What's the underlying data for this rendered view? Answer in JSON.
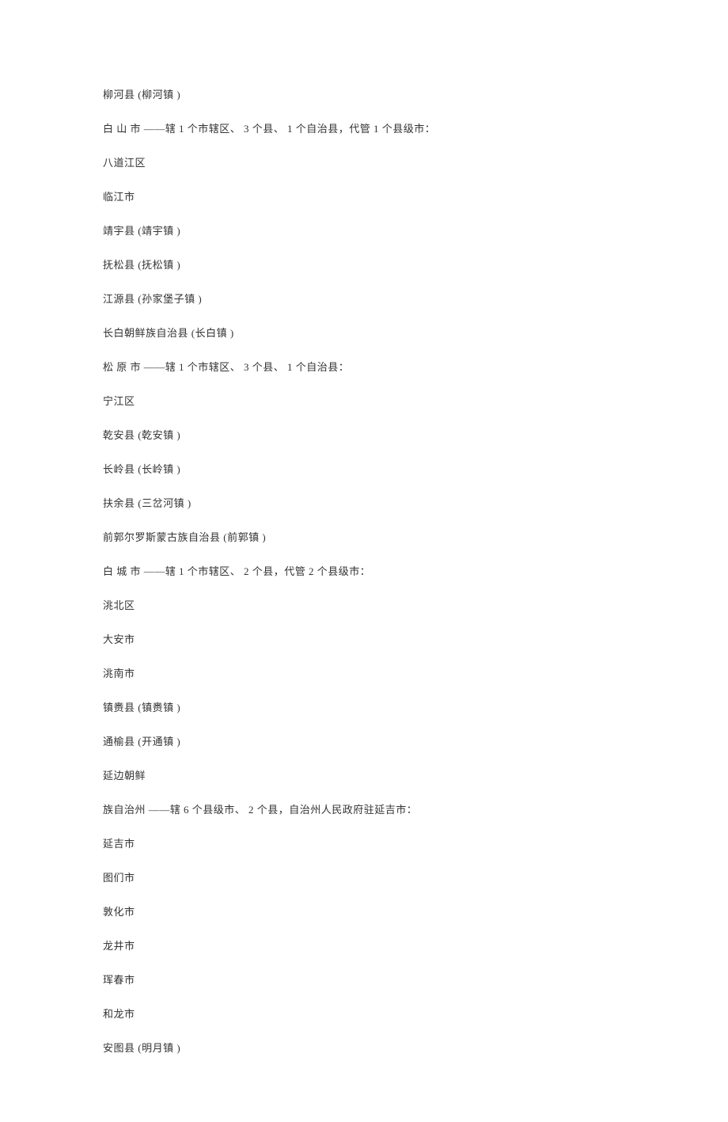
{
  "lines": [
    "柳河县 (柳河镇 )",
    "白  山  市 ——辖 1 个市辖区、  3 个县、 1 个自治县，代管   1 个县级市：",
    "八道江区",
    "临江市",
    "靖宇县 (靖宇镇 )",
    "抚松县 (抚松镇 )",
    "江源县 (孙家堡子镇  )",
    "长白朝鲜族自治县   (长白镇 )",
    "松  原  市 ——辖 1 个市辖区、  3 个县、 1 个自治县：",
    "宁江区",
    "乾安县 (乾安镇 )",
    "长岭县 (长岭镇 )",
    "扶余县 (三岔河镇  )",
    "前郭尔罗斯蒙古族自治县    (前郭镇 )",
    "白  城  市 ——辖 1 个市辖区、  2 个县，代管  2 个县级市：",
    "洮北区",
    "大安市",
    "洮南市",
    "镇赉县 (镇赉镇 )",
    "通榆县 (开通镇 )",
    "延边朝鲜",
    "族自治州 ——辖 6 个县级市、  2 个县，自治州人民政府驻延吉市：",
    "延吉市",
    "图们市",
    "敦化市",
    "龙井市",
    "珲春市",
    "和龙市",
    "安图县 (明月镇 )"
  ]
}
